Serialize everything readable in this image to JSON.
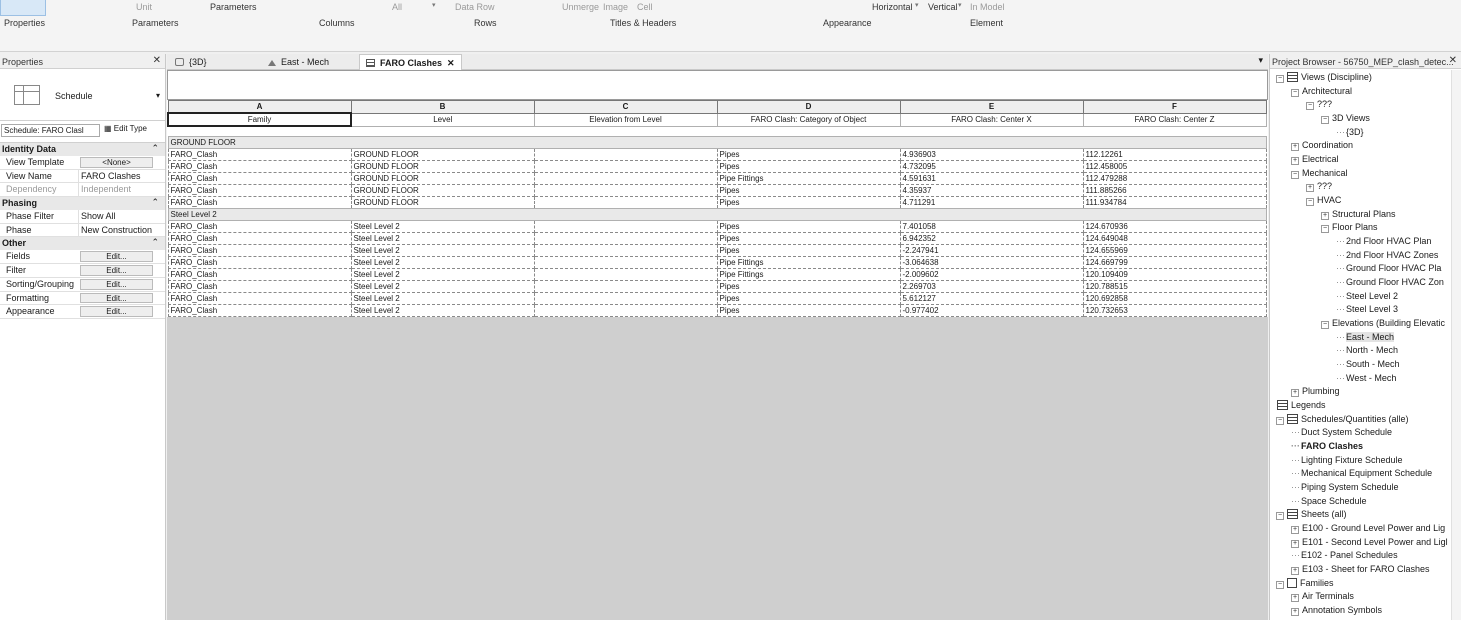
{
  "ribbon": {
    "top_row": {
      "unit": "Unit",
      "parameters": "Parameters",
      "all": "All",
      "data_row": "Data Row",
      "unmerge": "Unmerge",
      "image": "Image",
      "cell": "Cell",
      "horizontal": "Horizontal",
      "vertical": "Vertical",
      "in_model": "In Model"
    },
    "panels": [
      "Properties",
      "Parameters",
      "Columns",
      "Rows",
      "Titles & Headers",
      "Appearance",
      "Element"
    ]
  },
  "properties": {
    "title": "Properties",
    "type_name": "Schedule",
    "instance_selector": "Schedule: FARO Clasl",
    "edit_type": "Edit Type",
    "groups": {
      "identity": {
        "label": "Identity Data",
        "rows": [
          {
            "key": "View Template",
            "value": "<None>"
          },
          {
            "key": "View Name",
            "value": "FARO Clashes"
          },
          {
            "key": "Dependency",
            "value": "Independent"
          }
        ]
      },
      "phasing": {
        "label": "Phasing",
        "rows": [
          {
            "key": "Phase Filter",
            "value": "Show All"
          },
          {
            "key": "Phase",
            "value": "New Construction"
          }
        ]
      },
      "other": {
        "label": "Other",
        "rows": [
          {
            "key": "Fields",
            "value": "Edit..."
          },
          {
            "key": "Filter",
            "value": "Edit..."
          },
          {
            "key": "Sorting/Grouping",
            "value": "Edit..."
          },
          {
            "key": "Formatting",
            "value": "Edit..."
          },
          {
            "key": "Appearance",
            "value": "Edit..."
          }
        ]
      }
    }
  },
  "tabs": [
    {
      "label": "{3D}",
      "icon": "cube-icon"
    },
    {
      "label": "East - Mech",
      "icon": "elevation-icon"
    },
    {
      "label": "FARO Clashes",
      "icon": "schedule-icon",
      "active": true
    }
  ],
  "schedule": {
    "column_letters": [
      "A",
      "B",
      "C",
      "D",
      "E",
      "F"
    ],
    "headers": [
      "Family",
      "Level",
      "Elevation from Level",
      "FARO Clash: Category of Object",
      "FARO Clash: Center X",
      "FARO Clash: Center Z"
    ],
    "groups": [
      {
        "name": "GROUND FLOOR",
        "rows": [
          [
            "FARO_Clash",
            "GROUND FLOOR",
            "",
            "Pipes",
            "4.936903",
            "112.12261"
          ],
          [
            "FARO_Clash",
            "GROUND FLOOR",
            "",
            "Pipes",
            "4.732095",
            "112.458005"
          ],
          [
            "FARO_Clash",
            "GROUND FLOOR",
            "",
            "Pipe Fittings",
            "4.591631",
            "112.479288"
          ],
          [
            "FARO_Clash",
            "GROUND FLOOR",
            "",
            "Pipes",
            "4.35937",
            "111.885266"
          ],
          [
            "FARO_Clash",
            "GROUND FLOOR",
            "",
            "Pipes",
            "4.711291",
            "111.934784"
          ]
        ]
      },
      {
        "name": "Steel Level 2",
        "rows": [
          [
            "FARO_Clash",
            "Steel Level 2",
            "",
            "Pipes",
            "7.401058",
            "124.670936"
          ],
          [
            "FARO_Clash",
            "Steel Level 2",
            "",
            "Pipes",
            "6.942352",
            "124.649048"
          ],
          [
            "FARO_Clash",
            "Steel Level 2",
            "",
            "Pipes",
            "-2.247941",
            "124.655969"
          ],
          [
            "FARO_Clash",
            "Steel Level 2",
            "",
            "Pipe Fittings",
            "-3.064638",
            "124.669799"
          ],
          [
            "FARO_Clash",
            "Steel Level 2",
            "",
            "Pipe Fittings",
            "-2.009602",
            "120.109409"
          ],
          [
            "FARO_Clash",
            "Steel Level 2",
            "",
            "Pipes",
            "2.269703",
            "120.788515"
          ],
          [
            "FARO_Clash",
            "Steel Level 2",
            "",
            "Pipes",
            "5.612127",
            "120.692858"
          ],
          [
            "FARO_Clash",
            "Steel Level 2",
            "",
            "Pipes",
            "-0.977402",
            "120.732653"
          ]
        ]
      }
    ]
  },
  "browser": {
    "title": "Project Browser - 56750_MEP_clash_detec...",
    "nodes": [
      {
        "label": "Views (Discipline)",
        "depth": 0,
        "toggle": "-",
        "icon": "views"
      },
      {
        "label": "Architectural",
        "depth": 1,
        "toggle": "-"
      },
      {
        "label": "???",
        "depth": 2,
        "toggle": "-"
      },
      {
        "label": "3D Views",
        "depth": 3,
        "toggle": "-"
      },
      {
        "label": "{3D}",
        "depth": 4,
        "toggle": ""
      },
      {
        "label": "Coordination",
        "depth": 1,
        "toggle": "+"
      },
      {
        "label": "Electrical",
        "depth": 1,
        "toggle": "+"
      },
      {
        "label": "Mechanical",
        "depth": 1,
        "toggle": "-"
      },
      {
        "label": "???",
        "depth": 2,
        "toggle": "+"
      },
      {
        "label": "HVAC",
        "depth": 2,
        "toggle": "-"
      },
      {
        "label": "Structural Plans",
        "depth": 3,
        "toggle": "+"
      },
      {
        "label": "Floor Plans",
        "depth": 3,
        "toggle": "-"
      },
      {
        "label": "2nd Floor HVAC Plan",
        "depth": 4,
        "toggle": ""
      },
      {
        "label": "2nd Floor HVAC Zones",
        "depth": 4,
        "toggle": ""
      },
      {
        "label": "Ground Floor HVAC Pla",
        "depth": 4,
        "toggle": ""
      },
      {
        "label": "Ground Floor HVAC Zon",
        "depth": 4,
        "toggle": ""
      },
      {
        "label": "Steel Level 2",
        "depth": 4,
        "toggle": ""
      },
      {
        "label": "Steel Level 3",
        "depth": 4,
        "toggle": ""
      },
      {
        "label": "Elevations (Building Elevatic",
        "depth": 3,
        "toggle": "-"
      },
      {
        "label": "East - Mech",
        "depth": 4,
        "toggle": "",
        "selected": true
      },
      {
        "label": "North - Mech",
        "depth": 4,
        "toggle": ""
      },
      {
        "label": "South - Mech",
        "depth": 4,
        "toggle": ""
      },
      {
        "label": "West - Mech",
        "depth": 4,
        "toggle": ""
      },
      {
        "label": "Plumbing",
        "depth": 1,
        "toggle": "+"
      },
      {
        "label": "Legends",
        "depth": 0,
        "toggle": "",
        "icon": "grid"
      },
      {
        "label": "Schedules/Quantities (alle)",
        "depth": 0,
        "toggle": "-",
        "icon": "grid"
      },
      {
        "label": "Duct System Schedule",
        "depth": 1,
        "toggle": ""
      },
      {
        "label": "FARO Clashes",
        "depth": 1,
        "toggle": "",
        "bold": true
      },
      {
        "label": "Lighting Fixture Schedule",
        "depth": 1,
        "toggle": ""
      },
      {
        "label": "Mechanical Equipment Schedule",
        "depth": 1,
        "toggle": ""
      },
      {
        "label": "Piping System Schedule",
        "depth": 1,
        "toggle": ""
      },
      {
        "label": "Space Schedule",
        "depth": 1,
        "toggle": ""
      },
      {
        "label": "Sheets (all)",
        "depth": 0,
        "toggle": "-",
        "icon": "grid"
      },
      {
        "label": "E100 - Ground Level Power and Lig",
        "depth": 1,
        "toggle": "+"
      },
      {
        "label": "E101 - Second Level Power and Ligl",
        "depth": 1,
        "toggle": "+"
      },
      {
        "label": "E102 - Panel Schedules",
        "depth": 1,
        "toggle": ""
      },
      {
        "label": "E103 - Sheet for FARO Clashes",
        "depth": 1,
        "toggle": "+"
      },
      {
        "label": "Families",
        "depth": 0,
        "toggle": "-",
        "icon": "fam"
      },
      {
        "label": "Air Terminals",
        "depth": 1,
        "toggle": "+"
      },
      {
        "label": "Annotation Symbols",
        "depth": 1,
        "toggle": "+"
      }
    ]
  }
}
